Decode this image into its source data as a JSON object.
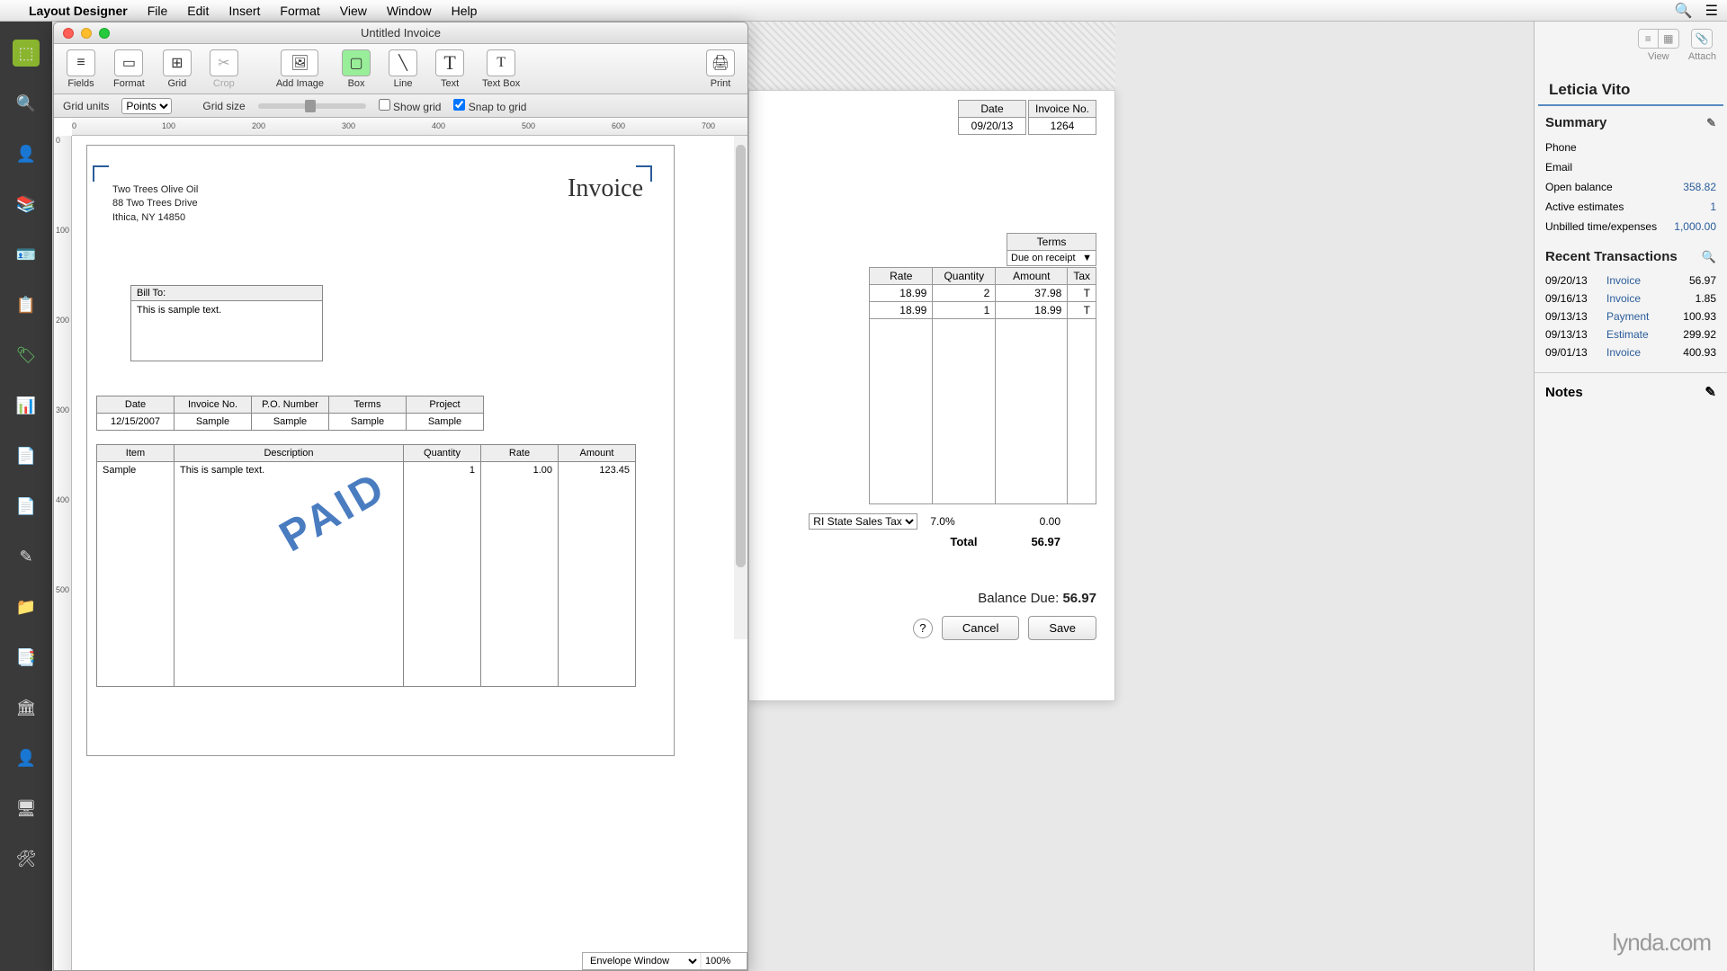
{
  "menubar": {
    "app": "Layout Designer",
    "items": [
      "File",
      "Edit",
      "Insert",
      "Format",
      "View",
      "Window",
      "Help"
    ]
  },
  "window": {
    "title": "Untitled Invoice"
  },
  "toolbar": {
    "fields": "Fields",
    "format": "Format",
    "grid": "Grid",
    "crop": "Crop",
    "add_image": "Add Image",
    "box": "Box",
    "line": "Line",
    "text": "Text",
    "text_box": "Text Box",
    "print": "Print"
  },
  "optionbar": {
    "grid_units_label": "Grid units",
    "grid_units_value": "Points",
    "grid_size_label": "Grid size",
    "show_grid": "Show grid",
    "snap": "Snap to grid"
  },
  "canvas": {
    "invoice_title": "Invoice",
    "company_line1": "Two Trees Olive Oil",
    "company_line2": "88 Two Trees Drive",
    "company_line3": "Ithica, NY 14850",
    "billto_label": "Bill To:",
    "billto_body": "This is sample text.",
    "mini": {
      "h": [
        "Date",
        "Invoice No.",
        "P.O. Number",
        "Terms",
        "Project"
      ],
      "v": [
        "12/15/2007",
        "Sample",
        "Sample",
        "Sample",
        "Sample"
      ]
    },
    "items": {
      "h": [
        "Item",
        "Description",
        "Quantity",
        "Rate",
        "Amount"
      ],
      "row": [
        "Sample",
        "This is sample text.",
        "1",
        "1.00",
        "123.45"
      ]
    },
    "watermark": "PAID",
    "envelope": "Envelope Window",
    "zoom": "100%"
  },
  "bg": {
    "date_label": "Date",
    "date_value": "09/20/13",
    "invno_label": "Invoice No.",
    "invno_value": "1264",
    "terms_label": "Terms",
    "terms_value": "Due on receipt",
    "cols": [
      "Rate",
      "Quantity",
      "Amount",
      "Tax"
    ],
    "rows": [
      [
        "18.99",
        "2",
        "37.98",
        "T"
      ],
      [
        "18.99",
        "1",
        "18.99",
        "T"
      ]
    ],
    "tax_item": "RI State Sales Tax",
    "tax_pct": "7.0%",
    "tax_amt": "0.00",
    "total_label": "Total",
    "total_value": "56.97",
    "balance_label": "Balance Due:",
    "balance_value": "56.97",
    "cancel": "Cancel",
    "save": "Save"
  },
  "right": {
    "view": "View",
    "attach": "Attach",
    "customer": "Leticia Vito",
    "summary_hdr": "Summary",
    "summary": [
      {
        "l": "Phone",
        "v": ""
      },
      {
        "l": "Email",
        "v": ""
      },
      {
        "l": "Open balance",
        "v": "358.82"
      },
      {
        "l": "Active estimates",
        "v": "1"
      },
      {
        "l": "Unbilled time/expenses",
        "v": "1,000.00"
      }
    ],
    "recent_hdr": "Recent Transactions",
    "recent": [
      {
        "d": "09/20/13",
        "t": "Invoice",
        "a": "56.97"
      },
      {
        "d": "09/16/13",
        "t": "Invoice",
        "a": "1.85"
      },
      {
        "d": "09/13/13",
        "t": "Payment",
        "a": "100.93"
      },
      {
        "d": "09/13/13",
        "t": "Estimate",
        "a": "299.92"
      },
      {
        "d": "09/01/13",
        "t": "Invoice",
        "a": "400.93"
      }
    ],
    "notes_hdr": "Notes"
  },
  "lynda": "lynda.com"
}
